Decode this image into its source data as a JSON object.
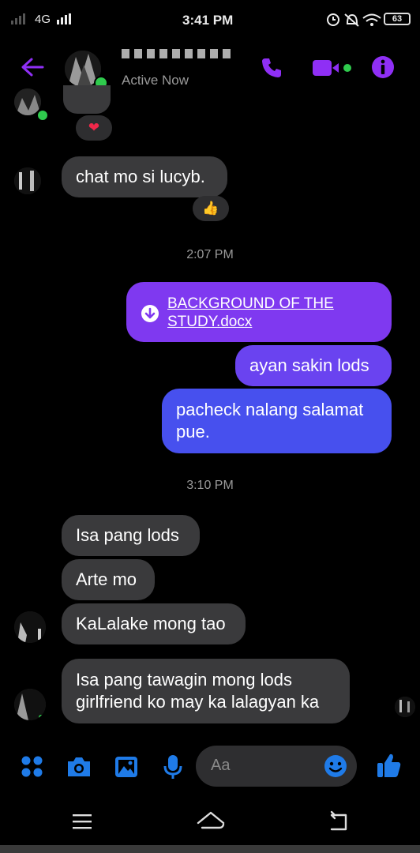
{
  "status_bar": {
    "network": "4G",
    "time": "3:41 PM",
    "battery": "63"
  },
  "header": {
    "presence": "Active Now",
    "icons": [
      "back-arrow-icon",
      "phone-icon",
      "video-icon",
      "info-icon"
    ]
  },
  "messages": {
    "incoming_reaction_heart": "❤",
    "incoming_1": "chat mo si lucyb.",
    "incoming_1_reaction": "👍",
    "time_1": "2:07 PM",
    "file_link": "BACKGROUND OF THE STUDY.docx",
    "out_1": "ayan sakin lods",
    "out_2": "pacheck nalang salamat pue.",
    "time_2": "3:10 PM",
    "incoming_2": "Isa pang lods",
    "incoming_3": "Arte mo",
    "incoming_4": "KaLalake mong tao",
    "incoming_5": "Isa pang tawagin mong lods girlfriend ko may ka lalagyan ka"
  },
  "composer": {
    "placeholder": "Aa",
    "icons": [
      "apps-grid-icon",
      "camera-icon",
      "gallery-icon",
      "microphone-icon",
      "emoji-icon",
      "thumbs-up-icon"
    ]
  },
  "colors": {
    "accent": "#8f2ff5",
    "outgoing_gradient_top": "#7f39f0",
    "outgoing_gradient_bottom": "#3f51ee",
    "incoming_bubble": "#3a3a3c",
    "toolbar_blue": "#1f7be8"
  }
}
